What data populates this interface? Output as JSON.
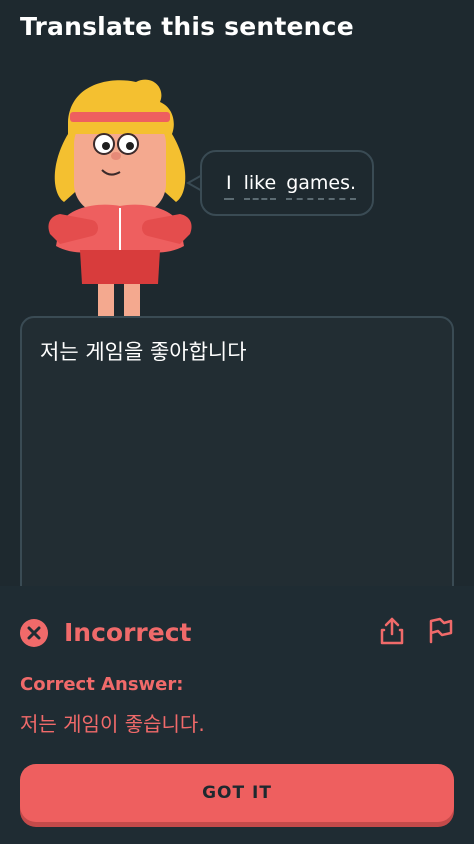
{
  "header": {
    "title": "Translate this sentence"
  },
  "prompt": {
    "words": [
      "I",
      "like",
      "games."
    ]
  },
  "answer_input": {
    "value": "저는 게임을 좋아합니다"
  },
  "feedback": {
    "status": "Incorrect",
    "correct_label": "Correct Answer:",
    "correct_answer": "저는 게임이 좋습니다.",
    "button_label": "GOT IT",
    "icons": [
      "close-icon",
      "share-icon",
      "flag-icon"
    ]
  },
  "colors": {
    "background": "#1e292f",
    "error": "#f06a6a",
    "button": "#ee5f5f",
    "border": "#3a4b54"
  }
}
